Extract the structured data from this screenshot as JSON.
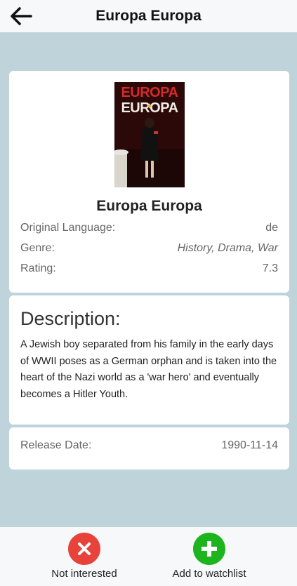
{
  "header": {
    "title": "Europa Europa",
    "back_icon": "arrow-left-icon"
  },
  "poster": {
    "title_line1": "EUROPA",
    "title_line2": "EUROPA"
  },
  "movie": {
    "title": "Europa Europa",
    "info": [
      {
        "label": "Original Language:",
        "value": "de"
      },
      {
        "label": "Genre:",
        "value": "History, Drama, War"
      },
      {
        "label": "Rating:",
        "value": "7.3"
      }
    ]
  },
  "description": {
    "heading": "Description:",
    "text": "A Jewish boy separated from his family in the early days of WWII poses as a German orphan and is taken into the heart of the Nazi world as a 'war hero' and eventually becomes a Hitler Youth."
  },
  "release": {
    "label": "Release Date:",
    "value": "1990-11-14"
  },
  "actions": {
    "not_interested": {
      "label": "Not interested",
      "icon": "close-circle-icon",
      "color": "#e8433a"
    },
    "add_watchlist": {
      "label": "Add to watchlist",
      "icon": "plus-circle-icon",
      "color": "#1db41d"
    }
  },
  "colors": {
    "background": "#bfd3db",
    "bars": "#f7f8fa",
    "card": "#ffffff"
  }
}
